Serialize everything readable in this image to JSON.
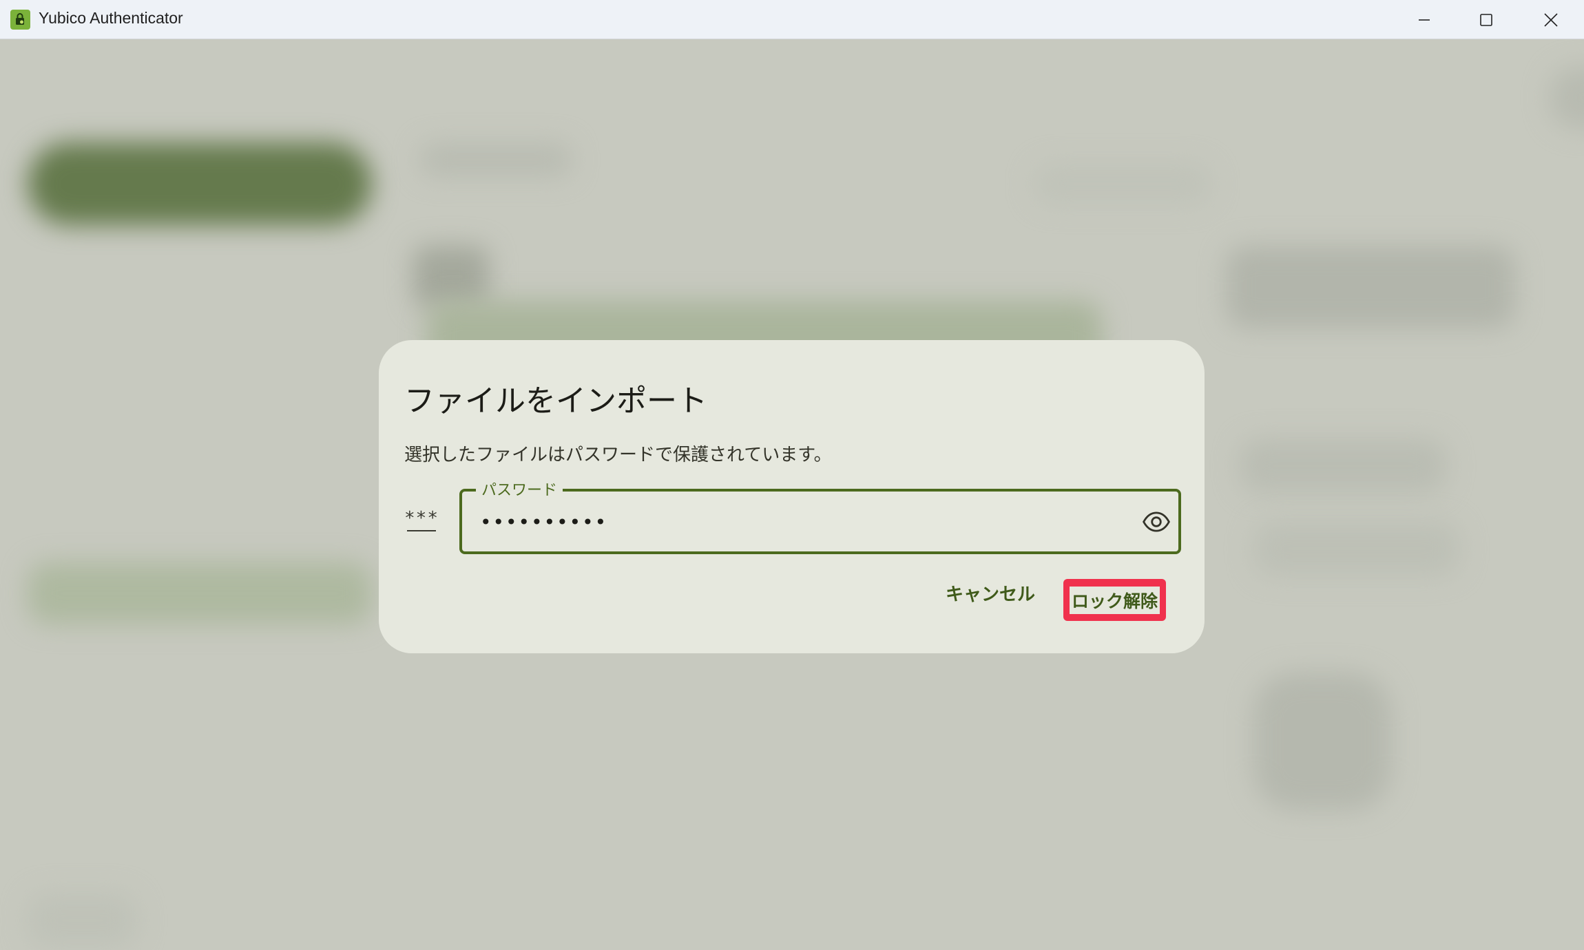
{
  "window": {
    "title": "Yubico Authenticator",
    "controls": {
      "minimize": "minimize",
      "maximize": "maximize",
      "close": "close"
    }
  },
  "dialog": {
    "title": "ファイルをインポート",
    "message": "選択したファイルはパスワードで保護されています。",
    "password_icon": "***",
    "password_field": {
      "label": "パスワード",
      "value": "••••••••••"
    },
    "cancel_label": "キャンセル",
    "unlock_label": "ロック解除"
  },
  "colors": {
    "accent": "#4c6a1e",
    "dialog_background": "#e6e8de",
    "highlight": "#f0314d",
    "backdrop": "#c7c9bf"
  }
}
